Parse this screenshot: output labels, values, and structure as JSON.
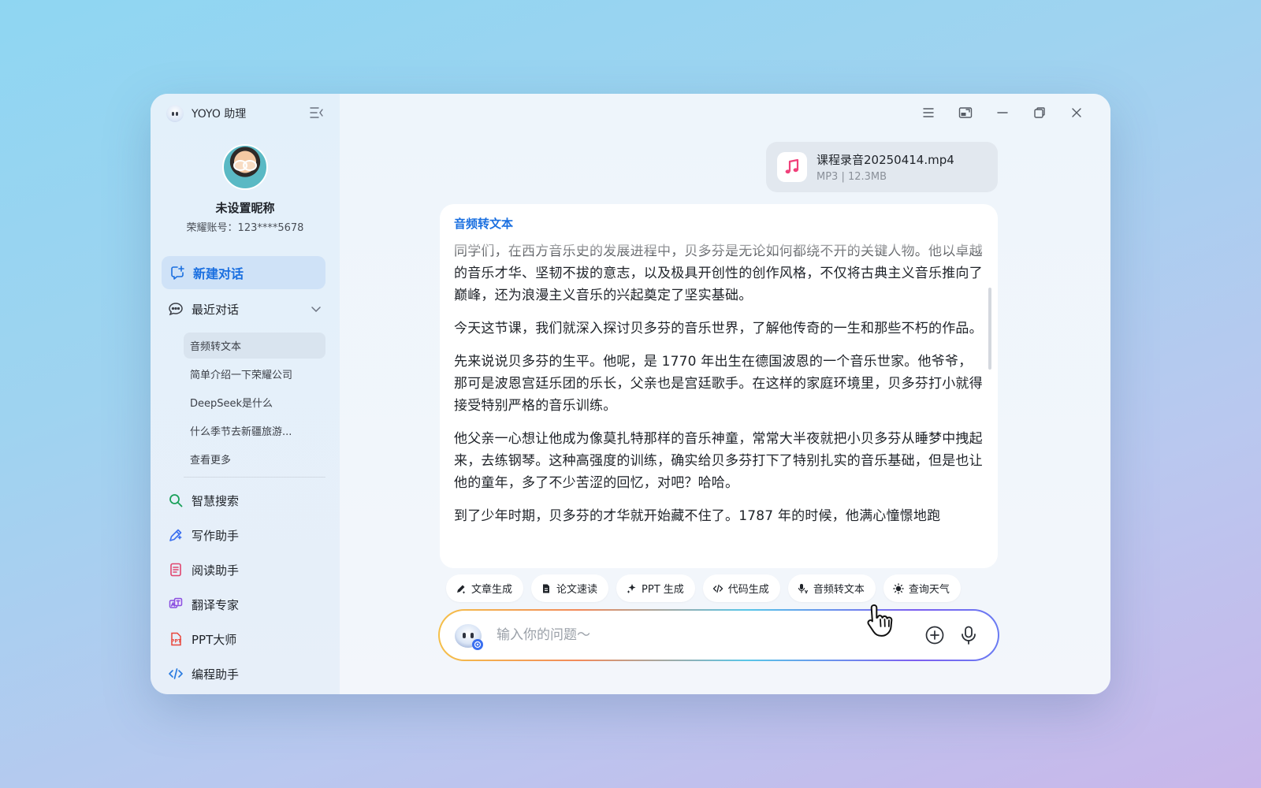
{
  "app": {
    "title": "YOYO 助理"
  },
  "profile": {
    "nickname": "未设置昵称",
    "account": "荣耀账号：123****5678"
  },
  "sidebar": {
    "new_chat": "新建对话",
    "recent_header": "最近对话",
    "recent_items": [
      "音频转文本",
      "简单介绍一下荣耀公司",
      "DeepSeek是什么",
      "什么季节去新疆旅游...",
      "查看更多"
    ],
    "tools": [
      {
        "label": "智慧搜索",
        "icon": "search-icon",
        "color": "#1aa05a"
      },
      {
        "label": "写作助手",
        "icon": "pen-icon",
        "color": "#3a6ff0"
      },
      {
        "label": "阅读助手",
        "icon": "document-icon",
        "color": "#e0456e"
      },
      {
        "label": "翻译专家",
        "icon": "translate-icon",
        "color": "#8a4fe0"
      },
      {
        "label": "PPT大师",
        "icon": "ppt-icon",
        "color": "#e8463c"
      },
      {
        "label": "编程助手",
        "icon": "code-icon",
        "color": "#2a7be0"
      }
    ]
  },
  "file": {
    "name": "课程录音20250414.mp4",
    "info": "MP3  |  12.3MB"
  },
  "message": {
    "title": "音频转文本",
    "paragraphs": [
      "同学们，在西方音乐史的发展进程中，贝多芬是无论如何都绕不开的关键人物。他以卓越的音乐才华、坚韧不拔的意志，以及极具开创性的创作风格，不仅将古典主义音乐推向了巅峰，还为浪漫主义音乐的兴起奠定了坚实基础。",
      "今天这节课，我们就深入探讨贝多芬的音乐世界，了解他传奇的一生和那些不朽的作品。",
      "先来说说贝多芬的生平。他呢，是 1770 年出生在德国波恩的一个音乐世家。他爷爷，那可是波恩宫廷乐团的乐长，父亲也是宫廷歌手。在这样的家庭环境里，贝多芬打小就得接受特别严格的音乐训练。",
      "他父亲一心想让他成为像莫扎特那样的音乐神童，常常大半夜就把小贝多芬从睡梦中拽起来，去练钢琴。这种高强度的训练，确实给贝多芬打下了特别扎实的音乐基础，但是也让他的童年，多了不少苦涩的回忆，对吧？哈哈。",
      "到了少年时期，贝多芬的才华就开始藏不住了。1787  年的时候，他满心憧憬地跑"
    ]
  },
  "chips": [
    "文章生成",
    "论文速读",
    "PPT 生成",
    "代码生成",
    "音频转文本",
    "查询天气"
  ],
  "input": {
    "placeholder": "输入你的问题～"
  },
  "colors": {
    "accent": "#1a6fe0",
    "music_icon": "#f0407a"
  }
}
